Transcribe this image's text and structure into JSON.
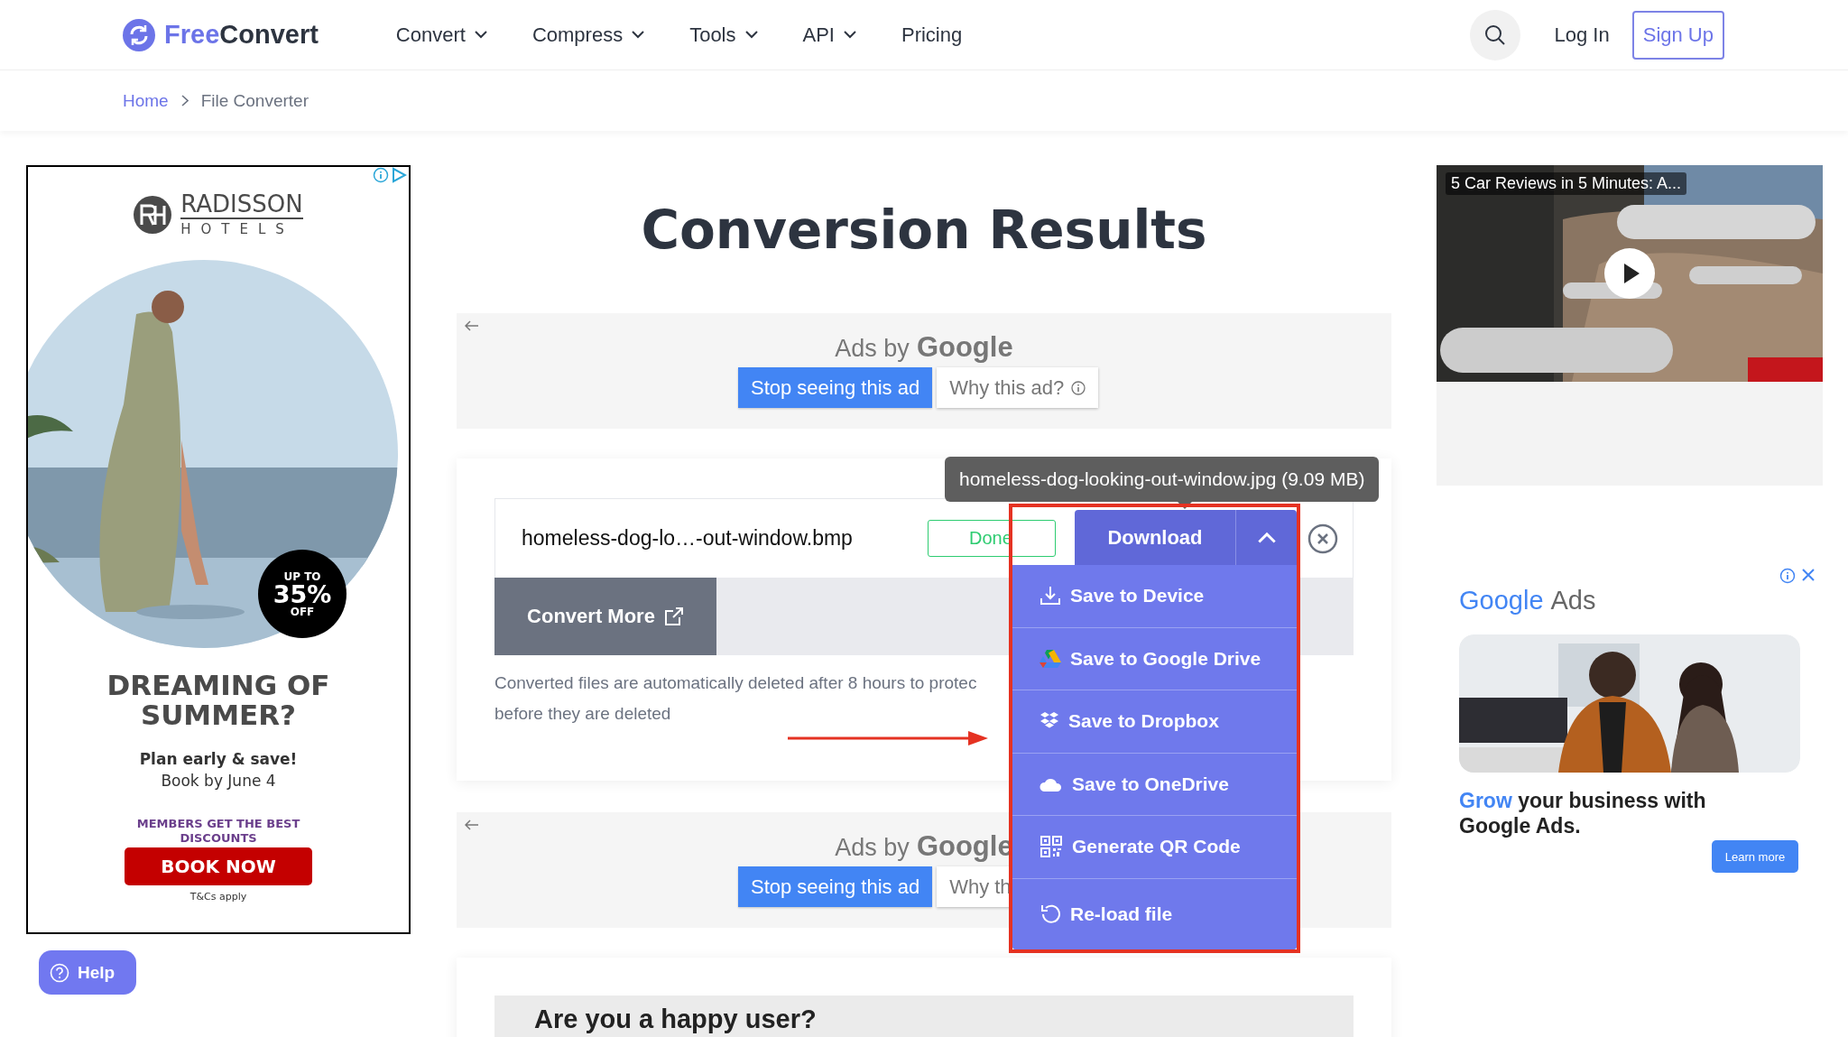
{
  "header": {
    "logo": {
      "accent": "Free",
      "rest": "Convert"
    },
    "nav": [
      {
        "label": "Convert",
        "dropdown": true
      },
      {
        "label": "Compress",
        "dropdown": true
      },
      {
        "label": "Tools",
        "dropdown": true
      },
      {
        "label": "API",
        "dropdown": true
      },
      {
        "label": "Pricing",
        "dropdown": false
      }
    ],
    "login": "Log In",
    "signup": "Sign Up"
  },
  "breadcrumb": [
    "Home",
    "File Converter"
  ],
  "left_ad": {
    "brand": "RADISSON",
    "brand_sub": "HOTELS",
    "badge_top": "UP TO",
    "badge_value": "35%",
    "badge_bottom": "OFF",
    "headline": "DREAMING OF SUMMER?",
    "line1": "Plan early & save!",
    "line2": "Book by June 4",
    "members": "MEMBERS GET THE BEST DISCOUNTS",
    "cta": "BOOK NOW",
    "terms": "T&Cs apply"
  },
  "help": "Help",
  "title": "Conversion Results",
  "ad_strips": [
    {
      "ads_by": "Ads by",
      "brand": "Google",
      "stop": "Stop seeing this ad",
      "why": "Why this ad?",
      "why_info": true
    },
    {
      "ads_by": "Ads by",
      "brand": "Google",
      "stop": "Stop seeing this ad",
      "why": "Why th"
    }
  ],
  "result": {
    "file_name": "homeless-dog-lo…-out-window.bmp",
    "status": "Done",
    "download": "Download",
    "menu_open": true,
    "tooltip": "homeless-dog-looking-out-window.jpg (9.09 MB)",
    "convert_more": "Convert More",
    "note_lines": [
      "Converted files are automatically deleted after 8 hours to protec",
      "before they are deleted"
    ],
    "menu": [
      {
        "label": "Save to Device",
        "kind": "device"
      },
      {
        "label": "Save to Google Drive",
        "kind": "drive"
      },
      {
        "label": "Save to Dropbox",
        "kind": "dropbox"
      },
      {
        "label": "Save to OneDrive",
        "kind": "onedrive"
      },
      {
        "label": "Generate QR Code",
        "kind": "qr"
      },
      {
        "label": "Re-load file",
        "kind": "reload"
      }
    ]
  },
  "happy": "Are you a happy user?",
  "right": {
    "video_title": "5 Car Reviews in 5 Minutes: A...",
    "ad_logo_a": "Google",
    "ad_logo_b": "Ads",
    "ad_headline": "*Grow* your business with Google Ads.",
    "ad_cta": "Learn more"
  }
}
